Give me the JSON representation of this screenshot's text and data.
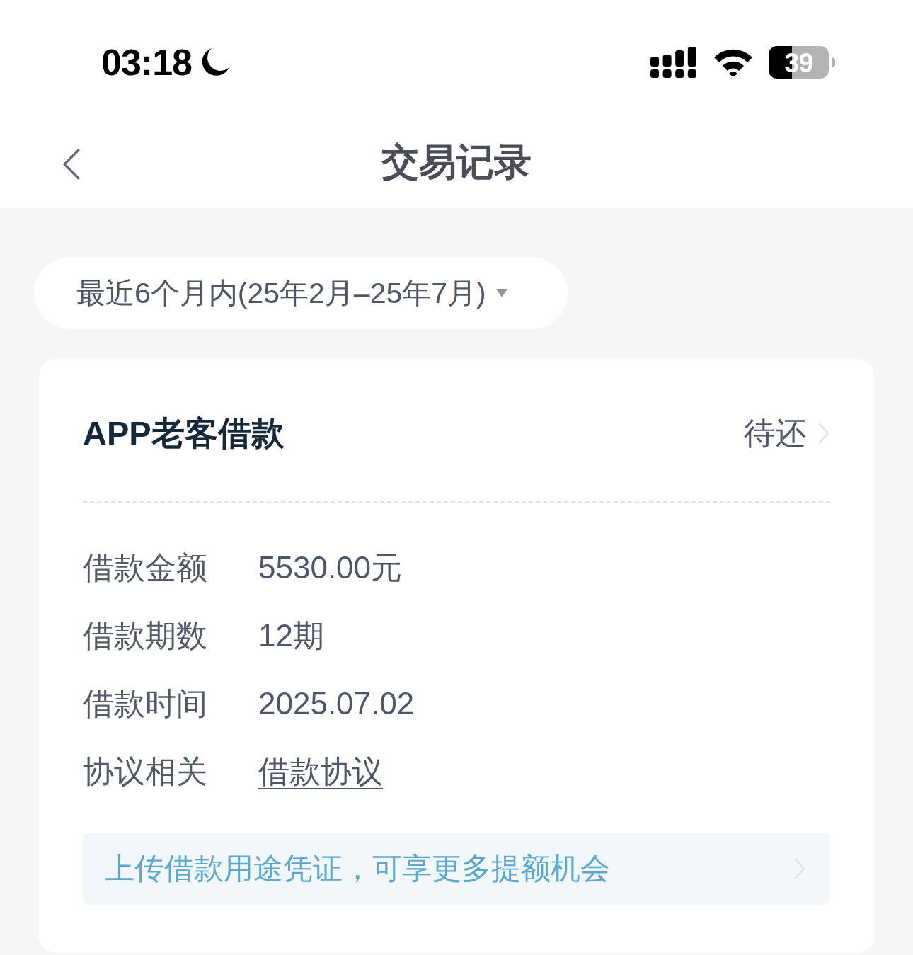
{
  "status_bar": {
    "time": "03:18",
    "battery": "39"
  },
  "nav": {
    "title": "交易记录"
  },
  "filter": {
    "label": "最近6个月内(25年2月–25年7月)"
  },
  "records": [
    {
      "title": "APP老客借款",
      "status": "待还",
      "fields": [
        {
          "kind": "text",
          "label": "借款金额",
          "value": "5530.00元"
        },
        {
          "kind": "text",
          "label": "借款期数",
          "value": "12期"
        },
        {
          "kind": "text",
          "label": "借款时间",
          "value": "2025.07.02"
        },
        {
          "kind": "link",
          "label": "协议相关",
          "value": "借款协议"
        }
      ],
      "banner": "上传借款用途凭证，可享更多提额机会"
    }
  ]
}
